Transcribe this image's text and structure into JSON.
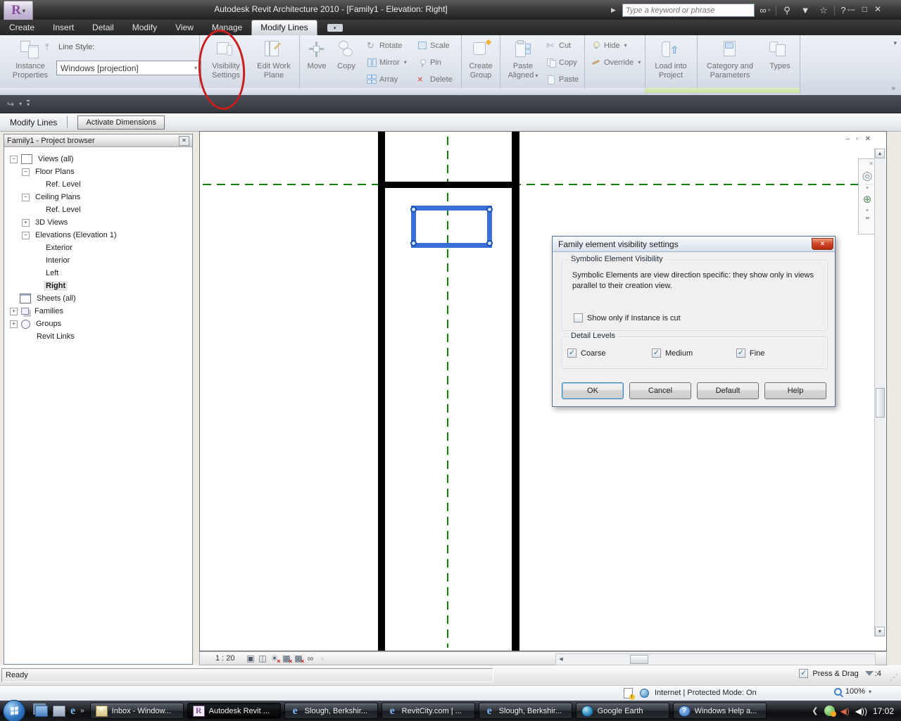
{
  "app": {
    "title": "Autodesk Revit Architecture 2010 - [Family1 - Elevation: Right]",
    "infocenter_placeholder": "Type a keyword or phrase"
  },
  "tabs": [
    "Create",
    "Insert",
    "Detail",
    "Modify",
    "View",
    "Manage"
  ],
  "active_tab": "Modify Lines",
  "ribbon": {
    "instance_properties": "Instance Properties",
    "line_style_label": "Line Style:",
    "line_style_value": "Windows [projection]",
    "visibility_settings": "Visibility Settings",
    "edit_work_plane": "Edit Work Plane",
    "move": "Move",
    "copy": "Copy",
    "rotate": "Rotate",
    "mirror": "Mirror",
    "array": "Array",
    "scale": "Scale",
    "pin": "Pin",
    "delete": "Delete",
    "create_group": "Create Group",
    "paste_aligned": "Paste Aligned",
    "cut": "Cut",
    "copy2": "Copy",
    "paste": "Paste",
    "hide": "Hide",
    "override": "Override",
    "load_into_project": "Load into Project",
    "category_and_parameters": "Category and Parameters",
    "types": "Types"
  },
  "options_bar": {
    "label": "Modify Lines",
    "activate_dimensions": "Activate Dimensions"
  },
  "project_browser": {
    "title": "Family1 - Project browser",
    "items": [
      {
        "label": "Views (all)",
        "level": 0,
        "expand": "minus",
        "icon": "views"
      },
      {
        "label": "Floor Plans",
        "level": 1,
        "expand": "minus"
      },
      {
        "label": "Ref. Level",
        "level": 2
      },
      {
        "label": "Ceiling Plans",
        "level": 1,
        "expand": "minus"
      },
      {
        "label": "Ref. Level",
        "level": 2
      },
      {
        "label": "3D Views",
        "level": 1,
        "expand": "plus"
      },
      {
        "label": "Elevations (Elevation 1)",
        "level": 1,
        "expand": "minus"
      },
      {
        "label": "Exterior",
        "level": 2
      },
      {
        "label": "Interior",
        "level": 2
      },
      {
        "label": "Left",
        "level": 2
      },
      {
        "label": "Right",
        "level": 2,
        "selected": true
      },
      {
        "label": "Sheets (all)",
        "level": 0,
        "icon": "sheets"
      },
      {
        "label": "Families",
        "level": 0,
        "expand": "plus",
        "icon": "families"
      },
      {
        "label": "Groups",
        "level": 0,
        "expand": "plus",
        "icon": "groups"
      },
      {
        "label": "Revit Links",
        "level": 0,
        "icon": "links"
      }
    ]
  },
  "dialog": {
    "title": "Family element visibility settings",
    "symbolic_group_title": "Symbolic Element Visibility",
    "symbolic_text": "Symbolic Elements are view direction specific: they show only in views parallel to their creation view.",
    "show_only_checkbox": {
      "label": "Show only if Instance is cut",
      "checked": false
    },
    "detail_group_title": "Detail Levels",
    "detail_levels": [
      {
        "label": "Coarse",
        "checked": true
      },
      {
        "label": "Medium",
        "checked": true
      },
      {
        "label": "Fine",
        "checked": true
      }
    ],
    "buttons": [
      "OK",
      "Cancel",
      "Default",
      "Help"
    ]
  },
  "view_control_bar": {
    "scale": "1 : 20"
  },
  "status_bar": {
    "message": "Ready",
    "press_drag": {
      "label": "Press & Drag",
      "checked": true
    },
    "filter_count": ":4"
  },
  "ie_status": {
    "zone": "Internet | Protected Mode: On",
    "zoom": "100%"
  },
  "taskbar": {
    "buttons": [
      {
        "label": "Inbox - Window...",
        "icon": "mail",
        "active": false
      },
      {
        "label": "Autodesk Revit ...",
        "icon": "revit",
        "active": true
      },
      {
        "label": "Slough, Berkshir...",
        "icon": "ie",
        "active": false
      },
      {
        "label": "RevitCity.com | ...",
        "icon": "ie",
        "active": false
      },
      {
        "label": "Slough, Berkshir...",
        "icon": "ie",
        "active": false
      },
      {
        "label": "Google Earth",
        "icon": "earth",
        "active": false
      },
      {
        "label": "Windows Help a...",
        "icon": "help",
        "active": false
      }
    ],
    "clock": "17:02"
  },
  "colors": {
    "selection_blue": "#3a6fd8",
    "reference_green": "#128112",
    "annotation_red": "#c81e1e",
    "family_panel_green": "#c3e09b"
  }
}
